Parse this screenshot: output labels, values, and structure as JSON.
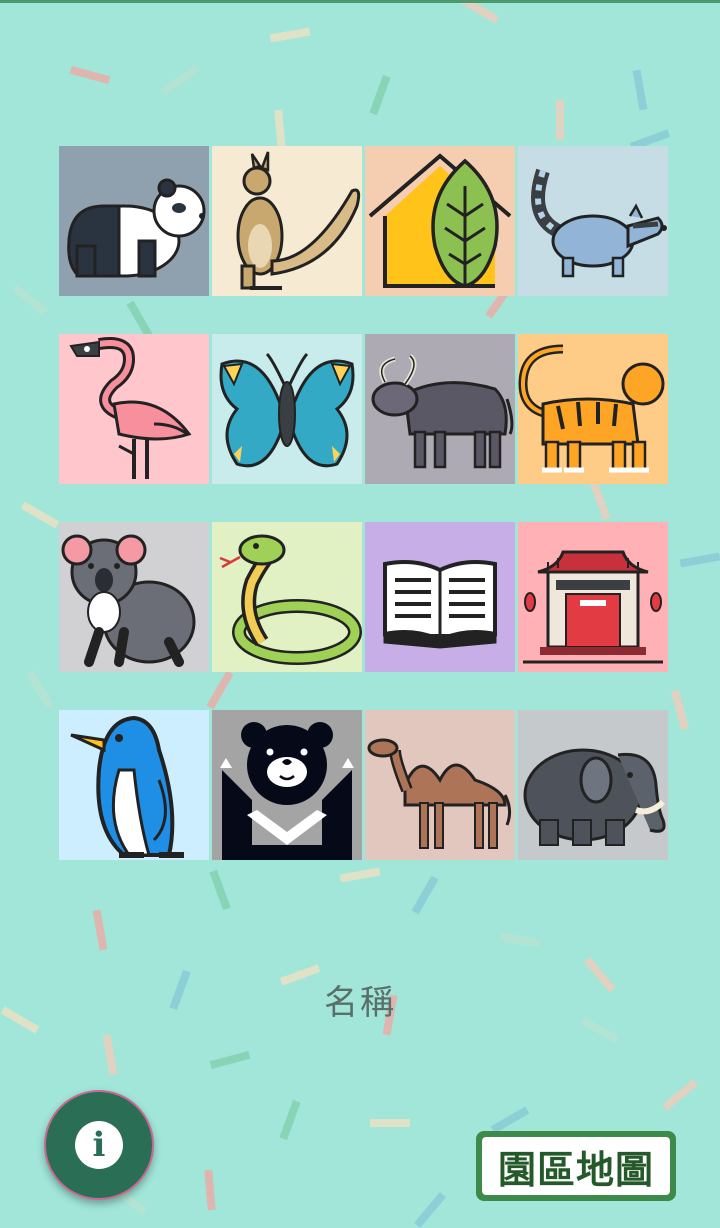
{
  "tiles": [
    {
      "name": "panda",
      "bg": "#8fa1af"
    },
    {
      "name": "kangaroo",
      "bg": "#f6ebd2"
    },
    {
      "name": "eco-house",
      "bg": "#f5cdb0"
    },
    {
      "name": "raccoon",
      "bg": "#c6dde5"
    },
    {
      "name": "flamingo",
      "bg": "#ffc6cc"
    },
    {
      "name": "butterfly",
      "bg": "#c8ecec"
    },
    {
      "name": "water-buffalo",
      "bg": "#aeaab4"
    },
    {
      "name": "tiger",
      "bg": "#ffcc88"
    },
    {
      "name": "koala",
      "bg": "#d1d1d4"
    },
    {
      "name": "snake",
      "bg": "#e2f1c4"
    },
    {
      "name": "book",
      "bg": "#c8aee6"
    },
    {
      "name": "temple",
      "bg": "#ffb1b5"
    },
    {
      "name": "penguin",
      "bg": "#cceeff"
    },
    {
      "name": "formosan-bear",
      "bg": "#a4a4a4"
    },
    {
      "name": "camel",
      "bg": "#e1c7bd"
    },
    {
      "name": "elephant",
      "bg": "#c6c9cb"
    }
  ],
  "caption": "名稱",
  "map_button": {
    "label": "園區地圖"
  },
  "info_button": {
    "glyph": "i"
  },
  "colors": {
    "background": "#a1e6d9",
    "info_fab": "#2b6e56",
    "map_border": "#3e8a4a"
  }
}
